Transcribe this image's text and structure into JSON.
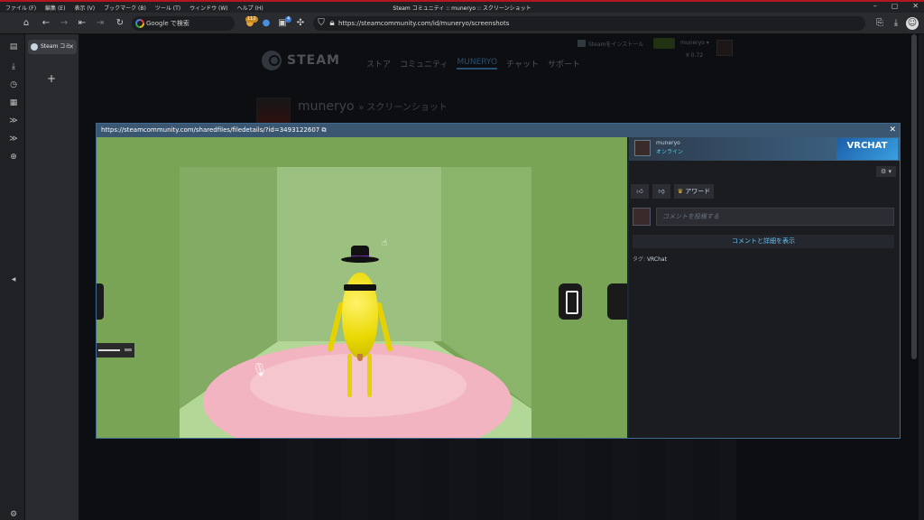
{
  "window": {
    "title": "Steam コミュニティ :: muneryo :: スクリーンショット",
    "menu": [
      "ファイル (F)",
      "編集 (E)",
      "表示 (V)",
      "ブックマーク (B)",
      "ツール (T)",
      "ウィンドウ (W)",
      "ヘルプ (H)"
    ],
    "controls": [
      "–",
      "▢",
      "✕"
    ]
  },
  "toolbar": {
    "search_placeholder": "Google で検索",
    "url": "https://steamcommunity.com/id/muneryo/screenshots",
    "badge_count": "112",
    "ext_badge": "4"
  },
  "sidebar": {
    "tab_label": "Steam コミ",
    "tab_close": "✕",
    "new_tab": "+"
  },
  "steam_header": {
    "logo": "STEAM",
    "nav": [
      "ストア",
      "コミュニティ",
      "MUNERYO",
      "チャット",
      "サポート"
    ],
    "install": "Steamをインストール",
    "account": "muneryo ▾",
    "wallet": "¥ 0.72"
  },
  "profile": {
    "name": "muneryo",
    "section": "スクリーンショット"
  },
  "modal": {
    "url": "https://steamcommunity.com/sharedfiles/filedetails/?id=3493122607",
    "close": "✕",
    "author": "muneryo",
    "status": "オンライン",
    "game_banner": "VRCHAT",
    "gear": "⚙ ▾",
    "award_label": "アワード",
    "comment_placeholder": "コメントを投稿する",
    "comments_link": "コメントと詳細を表示",
    "tags_label": "タグ:",
    "tag_value": "VRChat"
  },
  "colors": {
    "accent": "#67c1f5",
    "online": "#57cbde",
    "modal_header": "#3a5670"
  }
}
